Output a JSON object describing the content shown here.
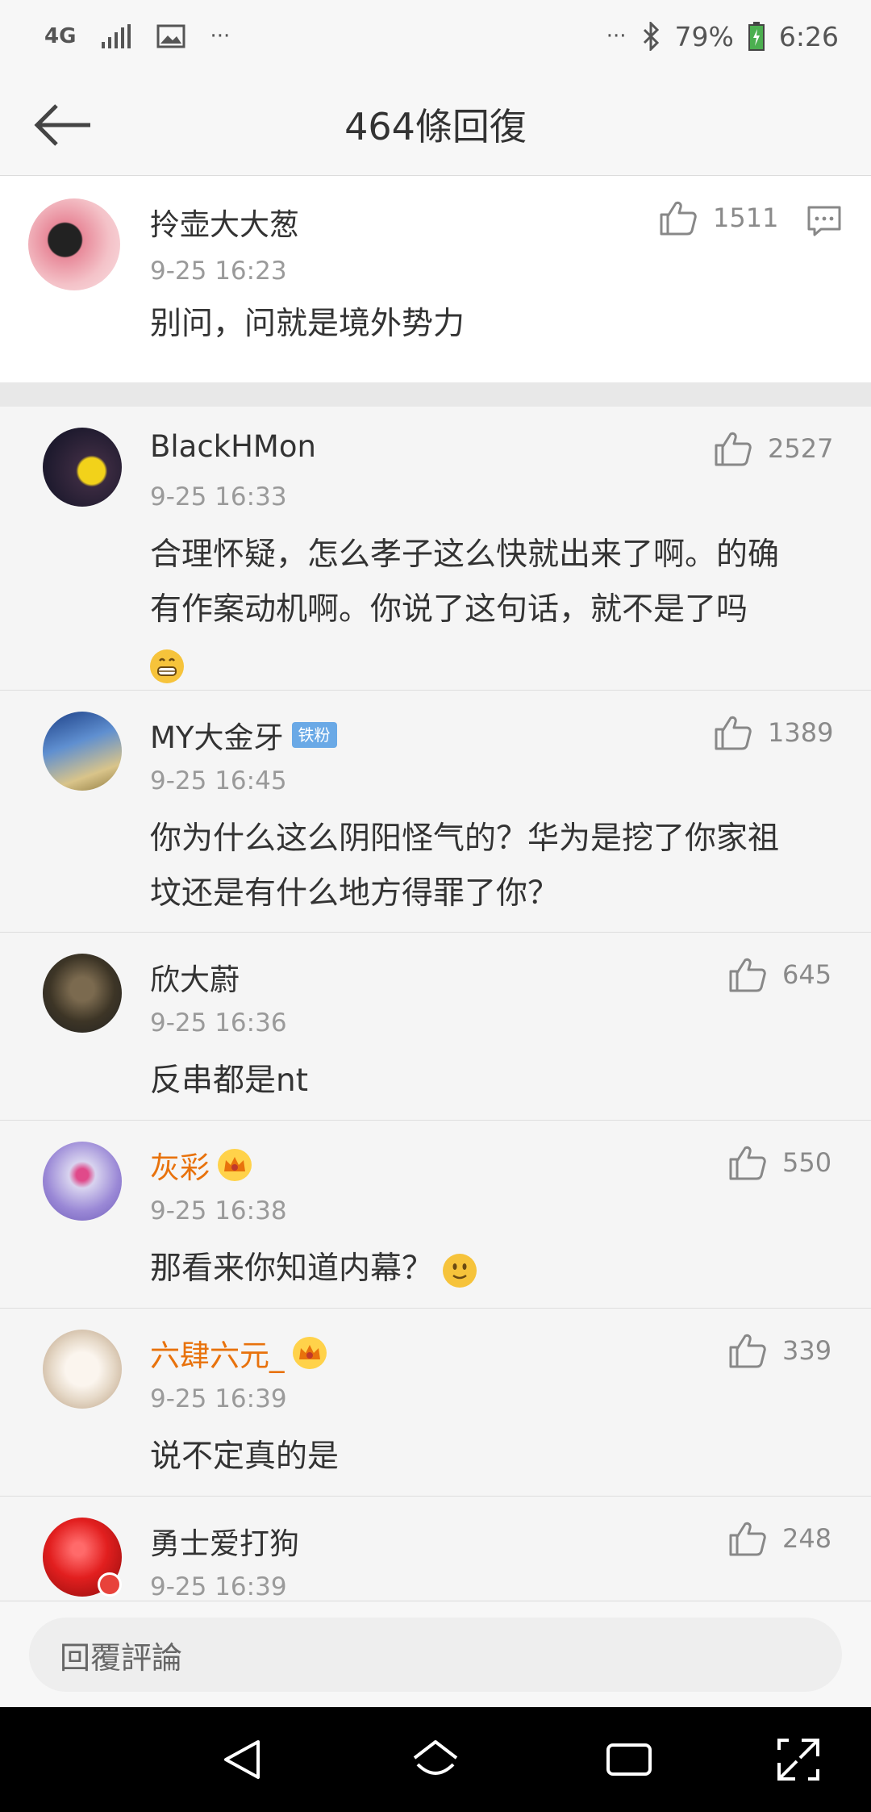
{
  "status": {
    "network": "4G",
    "more": "···",
    "battery": "79%",
    "time": "6:26"
  },
  "header": {
    "title": "464條回復"
  },
  "main_comment": {
    "username": "拎壶大大葱",
    "time": "9-25 16:23",
    "text": "别问，问就是境外势力",
    "likes": "1511"
  },
  "replies": [
    {
      "username": "BlackHMon",
      "time": "9-25 16:33",
      "line1": "合理怀疑，怎么孝子这么快就出来了啊。的确",
      "line2": "有作案动机啊。你说了这句话，就不是了吗",
      "likes": "2527"
    },
    {
      "username": "MY大金牙",
      "badge": "铁粉",
      "time": "9-25 16:45",
      "line1": "你为什么这么阴阳怪气的？华为是挖了你家祖",
      "line2": "坟还是有什么地方得罪了你？",
      "likes": "1389"
    },
    {
      "username": "欣大蔚",
      "time": "9-25 16:36",
      "text": "反串都是nt",
      "likes": "645"
    },
    {
      "username": "灰彩",
      "time": "9-25 16:38",
      "text": "那看来你知道内幕？",
      "likes": "550"
    },
    {
      "username": "六肆六元_",
      "time": "9-25 16:39",
      "text": "说不定真的是",
      "likes": "339"
    },
    {
      "username": "勇士爱打狗",
      "time": "9-25 16:39",
      "likes": "248"
    }
  ],
  "reply_box": {
    "placeholder": "回覆評論"
  },
  "colors": {
    "orange_name": "#e8720c",
    "fan_badge": "#6aa9e6"
  }
}
